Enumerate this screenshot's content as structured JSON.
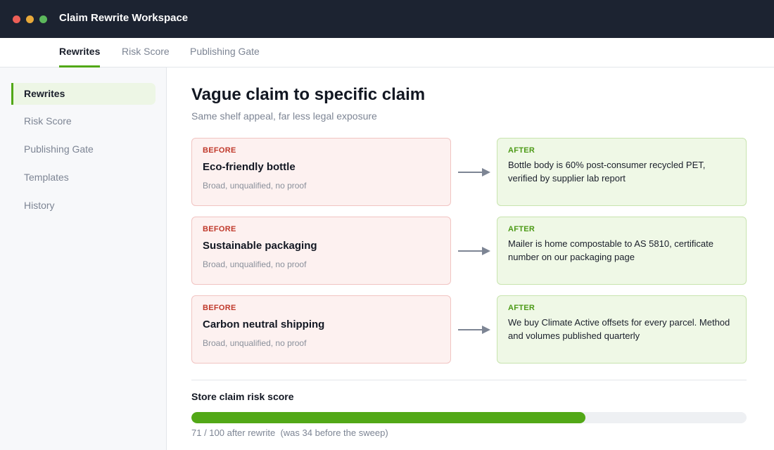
{
  "window": {
    "title": "Claim Rewrite Workspace",
    "lights": [
      "#ed5f57",
      "#e8a93a",
      "#5cb85c"
    ]
  },
  "tabs": [
    {
      "label": "Rewrites",
      "active": true
    },
    {
      "label": "Risk Score",
      "active": false
    },
    {
      "label": "Publishing Gate",
      "active": false
    }
  ],
  "sidebar": {
    "items": [
      {
        "label": "Rewrites",
        "active": true
      },
      {
        "label": "Risk Score",
        "active": false
      },
      {
        "label": "Publishing Gate",
        "active": false
      },
      {
        "label": "Templates",
        "active": false
      },
      {
        "label": "History",
        "active": false
      }
    ]
  },
  "main": {
    "title": "Vague claim to specific claim",
    "subtitle": "Same shelf appeal, far less legal exposure",
    "rewrites": [
      {
        "before_tag": "BEFORE",
        "before_claim": "Eco-friendly bottle",
        "before_note": "Broad, unqualified, no proof",
        "after_tag": "AFTER",
        "after_text": "Bottle body is 60% post-consumer recycled PET, verified by supplier lab report"
      },
      {
        "before_tag": "BEFORE",
        "before_claim": "Sustainable packaging",
        "before_note": "Broad, unqualified, no proof",
        "after_tag": "AFTER",
        "after_text": "Mailer is home compostable to AS 5810, certificate number on our packaging page"
      },
      {
        "before_tag": "BEFORE",
        "before_claim": "Carbon neutral shipping",
        "before_note": "Broad, unqualified, no proof",
        "after_tag": "AFTER",
        "after_text": "We buy Climate Active offsets for every parcel. Method and volumes published quarterly"
      }
    ],
    "arrow_icon": "arrow-right-icon",
    "score": {
      "title": "Store claim risk score",
      "value": 71,
      "max": 100,
      "caption": "71 / 100 after rewrite  (was 34 before the sweep)"
    }
  },
  "colors": {
    "accent": "#52a817",
    "before_tag": "#c0392b",
    "after_tag": "#4c9a16",
    "titlebar": "#1c2331"
  }
}
